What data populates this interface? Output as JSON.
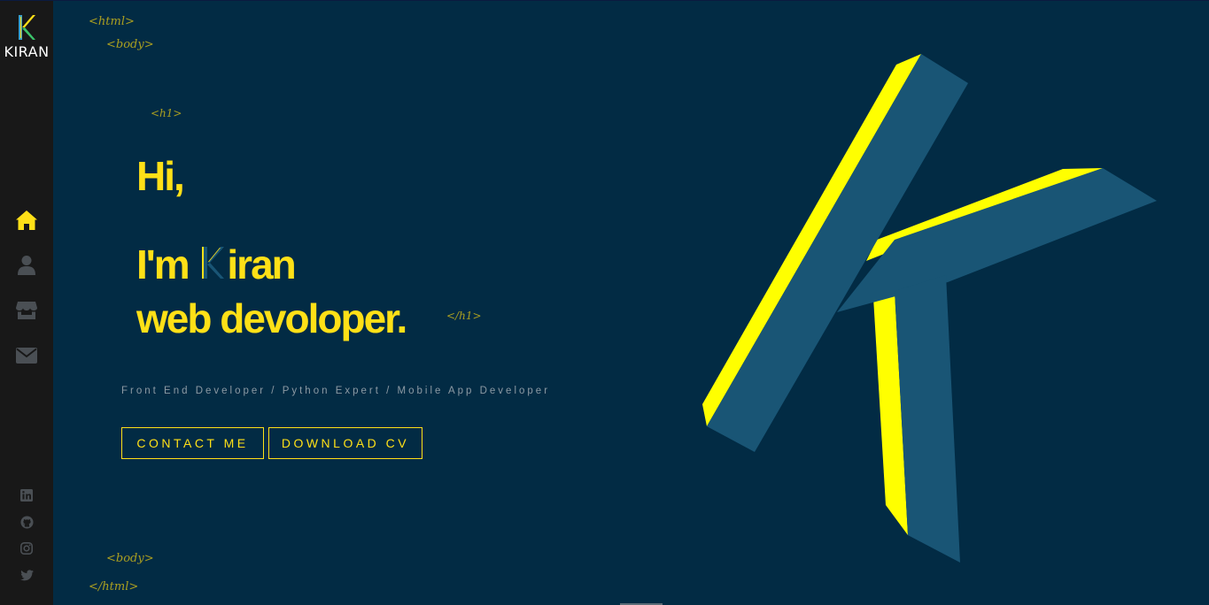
{
  "brand": {
    "name": "KIRAN",
    "logo_icon": "k-logo-icon"
  },
  "nav": [
    {
      "name": "home",
      "icon": "home-icon",
      "active": true
    },
    {
      "name": "about",
      "icon": "user-icon",
      "active": false
    },
    {
      "name": "portfolio",
      "icon": "store-icon",
      "active": false
    },
    {
      "name": "contact",
      "icon": "envelope-icon",
      "active": false
    }
  ],
  "social": [
    {
      "name": "linkedin",
      "icon": "linkedin-icon"
    },
    {
      "name": "github",
      "icon": "github-icon"
    },
    {
      "name": "instagram",
      "icon": "instagram-icon"
    },
    {
      "name": "twitter",
      "icon": "twitter-icon"
    }
  ],
  "code_tags": {
    "html_open": "<html>",
    "body_open": "<body>",
    "h1_open": "<h1>",
    "h1_close": "</h1>",
    "body_close": "<body>",
    "html_close": "</html>"
  },
  "hero": {
    "line1": "Hi,",
    "line2_prefix": "I'm",
    "line2_suffix": "iran",
    "line3": "web devoloper.",
    "subtitle": "Front End Developer / Python Expert / Mobile App Developer"
  },
  "buttons": {
    "contact": "CONTACT ME",
    "download": "DOWNLOAD CV"
  },
  "colors": {
    "background": "#022b44",
    "sidebar": "#181818",
    "accent": "#ffe017",
    "k_face": "#195575",
    "k_edge": "#ffff00",
    "code_tag": "#c9b41a",
    "subtitle": "#8d9aa4",
    "icon_inactive": "#4a4f54"
  }
}
